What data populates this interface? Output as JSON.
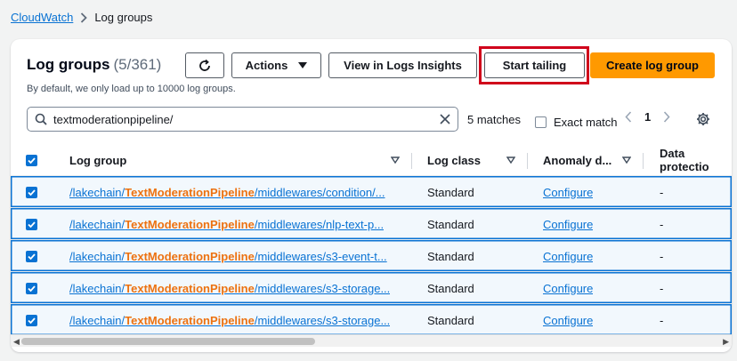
{
  "breadcrumb": {
    "parent": "CloudWatch",
    "current": "Log groups"
  },
  "header": {
    "title": "Log groups",
    "count": "(5/361)",
    "subtitle": "By default, we only load up to 10000 log groups."
  },
  "toolbar": {
    "actions_label": "Actions",
    "view_insights_label": "View in Logs Insights",
    "start_tailing_label": "Start tailing",
    "create_label": "Create log group"
  },
  "search": {
    "value": "textmoderationpipeline/",
    "matches": "5 matches",
    "exact_match_label": "Exact match"
  },
  "pagination": {
    "current_page": "1"
  },
  "table": {
    "columns": [
      "Log group",
      "Log class",
      "Anomaly d...",
      "Data protectio"
    ],
    "rows": [
      {
        "prefix": "/lakechain/",
        "highlight": "TextModerationPipeline",
        "suffix": "/middlewares/condition/...",
        "log_class": "Standard",
        "anomaly": "Configure",
        "data_protection": "-"
      },
      {
        "prefix": "/lakechain/",
        "highlight": "TextModerationPipeline",
        "suffix": "/middlewares/nlp-text-p...",
        "log_class": "Standard",
        "anomaly": "Configure",
        "data_protection": "-"
      },
      {
        "prefix": "/lakechain/",
        "highlight": "TextModerationPipeline",
        "suffix": "/middlewares/s3-event-t...",
        "log_class": "Standard",
        "anomaly": "Configure",
        "data_protection": "-"
      },
      {
        "prefix": "/lakechain/",
        "highlight": "TextModerationPipeline",
        "suffix": "/middlewares/s3-storage...",
        "log_class": "Standard",
        "anomaly": "Configure",
        "data_protection": "-"
      },
      {
        "prefix": "/lakechain/",
        "highlight": "TextModerationPipeline",
        "suffix": "/middlewares/s3-storage...",
        "log_class": "Standard",
        "anomaly": "Configure",
        "data_protection": "-"
      }
    ]
  },
  "colors": {
    "link": "#0972d3",
    "highlight": "#ec7211",
    "primary_button": "#ff9900",
    "focus_outline": "#d0021b"
  },
  "icons": {
    "refresh": "refresh-icon",
    "search": "search-icon",
    "clear": "close-icon",
    "settings": "gear-icon"
  }
}
